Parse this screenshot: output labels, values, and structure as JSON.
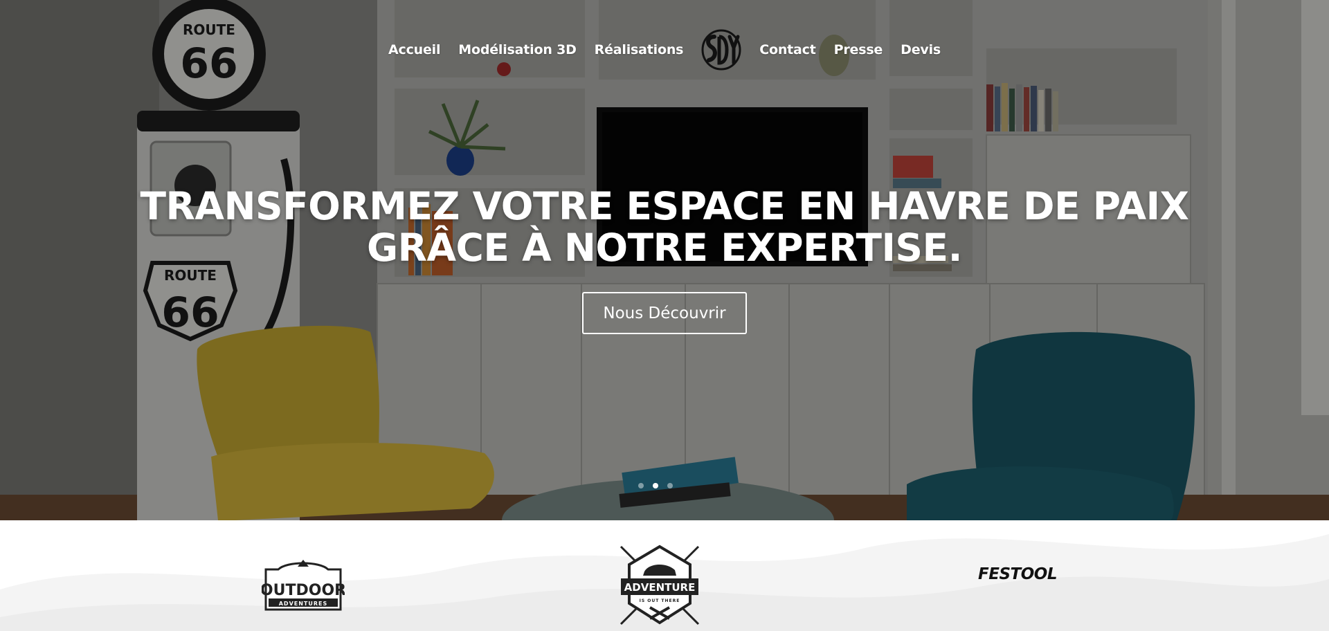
{
  "nav": {
    "items": [
      "Accueil",
      "Modélisation 3D",
      "Réalisations"
    ],
    "items_right": [
      "Contact",
      "Presse",
      "Devis"
    ],
    "logo_icon": "sdy-monogram-logo"
  },
  "hero": {
    "headline_line1": "TRANSFORMEZ VOTRE ESPACE EN HAVRE DE PAIX",
    "headline_line2": "GRÂCE À NOTRE EXPERTISE.",
    "cta_label": "Nous Découvrir",
    "slides_count": 3,
    "active_slide": 2,
    "background_photo": "living-room-with-route-66-gas-pump-yellow-chair-blue-armchair-white-shelving"
  },
  "partners": {
    "logos": [
      {
        "name": "outdoor-adventures-logo",
        "lines": [
          "OUTDOOR",
          "ADVENTURES"
        ]
      },
      {
        "name": "adventure-logo",
        "lines": [
          "ADVENTURE",
          "IS OUT THERE"
        ]
      },
      {
        "name": "festool-logo",
        "lines": [
          "FESTOOL"
        ]
      }
    ]
  },
  "colors": {
    "overlay": "#000000",
    "text": "#ffffff",
    "chair_yellow": "#d8b93c",
    "chair_teal": "#1d5f6e",
    "logo_dark": "#222222"
  }
}
